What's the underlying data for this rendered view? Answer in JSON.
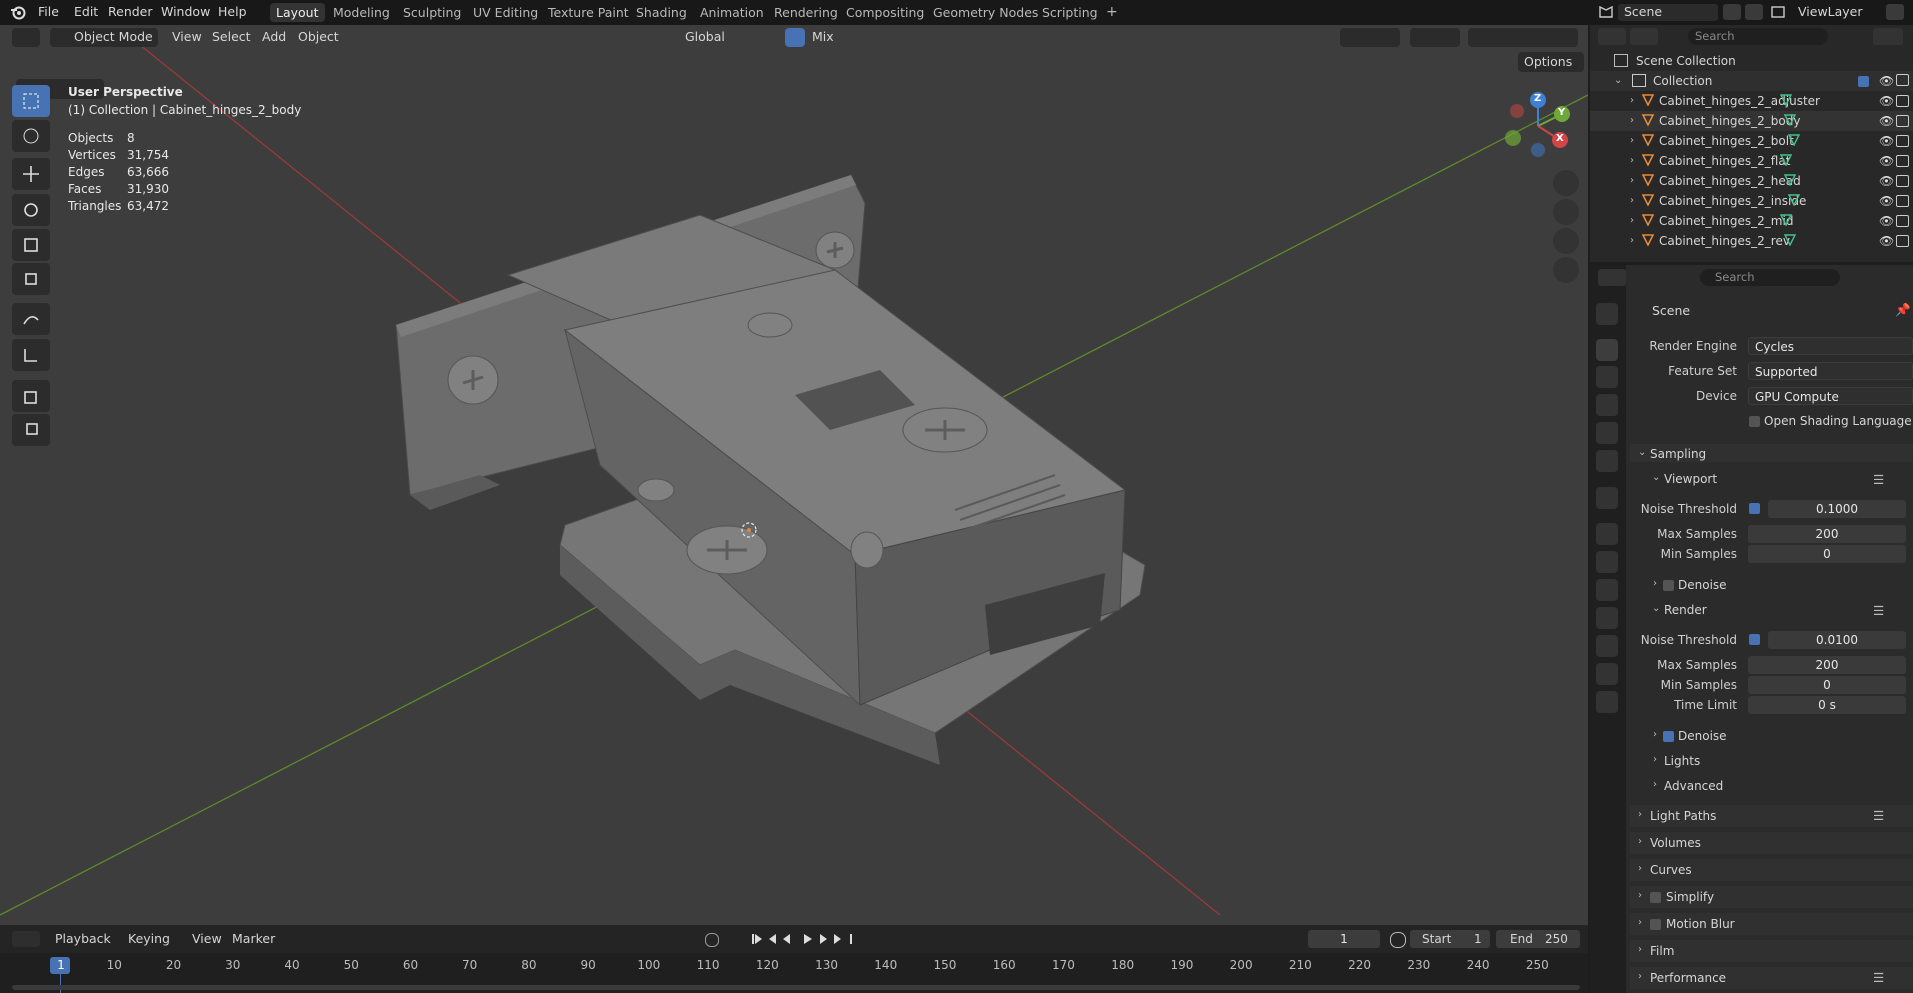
{
  "menu": {
    "file": "File",
    "edit": "Edit",
    "render": "Render",
    "window": "Window",
    "help": "Help"
  },
  "workspaces": [
    "Layout",
    "Modeling",
    "Sculpting",
    "UV Editing",
    "Texture Paint",
    "Shading",
    "Animation",
    "Rendering",
    "Compositing",
    "Geometry Nodes",
    "Scripting"
  ],
  "workspace_add": "+",
  "scene_name": "Scene",
  "view_layer": "ViewLayer",
  "viewport_header": {
    "mode": "Object Mode",
    "view": "View",
    "select": "Select",
    "add": "Add",
    "object": "Object",
    "transform": "Global",
    "snap": "Mix",
    "options": "Options"
  },
  "viewport_overlay": {
    "perspective": "User Perspective",
    "collection_line": "(1) Collection | Cabinet_hinges_2_body",
    "stats": [
      {
        "label": "Objects",
        "value": "8"
      },
      {
        "label": "Vertices",
        "value": "31,754"
      },
      {
        "label": "Edges",
        "value": "63,666"
      },
      {
        "label": "Faces",
        "value": "31,930"
      },
      {
        "label": "Triangles",
        "value": "63,472"
      }
    ]
  },
  "gizmo": {
    "z": "Z",
    "y": "Y",
    "x": "X"
  },
  "timeline": {
    "playback": "Playback",
    "keying": "Keying",
    "view": "View",
    "marker": "Marker",
    "current_frame": "1",
    "start_label": "Start",
    "start": "1",
    "end_label": "End",
    "end": "250",
    "ticks": [
      "1",
      "10",
      "20",
      "30",
      "40",
      "50",
      "60",
      "70",
      "80",
      "90",
      "100",
      "110",
      "120",
      "130",
      "140",
      "150",
      "160",
      "170",
      "180",
      "190",
      "200",
      "210",
      "220",
      "230",
      "240",
      "250"
    ]
  },
  "outliner": {
    "search_placeholder": "Search",
    "scene_collection": "Scene Collection",
    "collection": "Collection",
    "objects": [
      "Cabinet_hinges_2_adjuster",
      "Cabinet_hinges_2_body",
      "Cabinet_hinges_2_bolt",
      "Cabinet_hinges_2_flat",
      "Cabinet_hinges_2_head",
      "Cabinet_hinges_2_inside",
      "Cabinet_hinges_2_mid",
      "Cabinet_hinges_2_rev"
    ]
  },
  "properties": {
    "search_placeholder": "Search",
    "context": "Scene",
    "render_engine_label": "Render Engine",
    "render_engine": "Cycles",
    "feature_set_label": "Feature Set",
    "feature_set": "Supported",
    "device_label": "Device",
    "device": "GPU Compute",
    "osl": "Open Shading Language",
    "sampling": "Sampling",
    "viewport": "Viewport",
    "noise_threshold_label": "Noise Threshold",
    "viewport_noise": "0.1000",
    "max_samples_label": "Max Samples",
    "viewport_max": "200",
    "min_samples_label": "Min Samples",
    "viewport_min": "0",
    "denoise": "Denoise",
    "render": "Render",
    "render_noise": "0.0100",
    "render_max": "200",
    "render_min": "0",
    "time_limit_label": "Time Limit",
    "time_limit": "0 s",
    "lights": "Lights",
    "advanced": "Advanced",
    "sections": [
      "Light Paths",
      "Volumes",
      "Curves",
      "Simplify",
      "Motion Blur",
      "Film",
      "Performance"
    ]
  },
  "colors": {
    "accent": "#4772b3",
    "x_axis": "#c0392b",
    "y_axis": "#6a9a2a",
    "viewport_bg": "#3d3d3d"
  }
}
